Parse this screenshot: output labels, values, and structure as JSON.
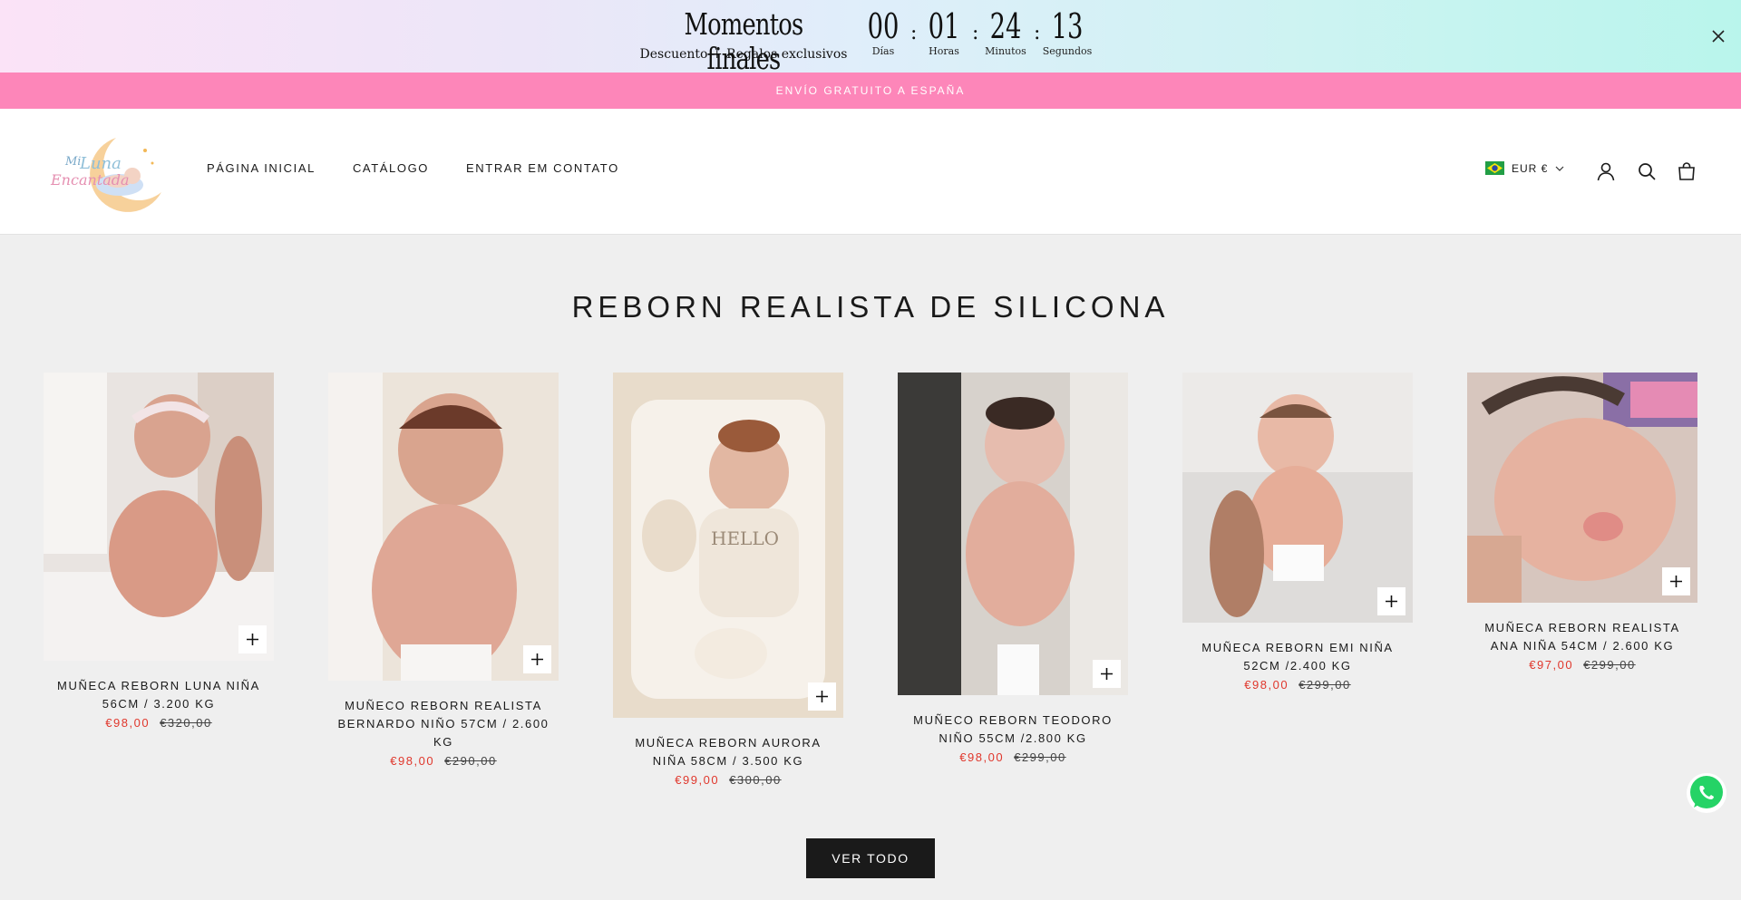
{
  "countdown": {
    "title": "Momentos finales",
    "subtitle": "Descuento + Regalos exclusivos",
    "units": [
      {
        "value": "00",
        "label": "Días"
      },
      {
        "value": "01",
        "label": "Horas"
      },
      {
        "value": "24",
        "label": "Minutos"
      },
      {
        "value": "13",
        "label": "Segundos"
      }
    ],
    "separator": ":"
  },
  "announcement": "ENVÍO GRATUITO A ESPAÑA",
  "header": {
    "logo_text": "Mi Luna Encantada",
    "nav": [
      "PÁGINA INICIAL",
      "CATÁLOGO",
      "ENTRAR EM CONTATO"
    ],
    "currency": "EUR €"
  },
  "section": {
    "title": "REBORN REALISTA DE SILICONA",
    "view_all": "VER TODO"
  },
  "products": [
    {
      "title": "MUÑECA REBORN LUNA NIÑA 56CM / 3.200 KG",
      "price": "€98,00",
      "compare": "€320,00"
    },
    {
      "title": "MUÑECO REBORN REALISTA BERNARDO NIÑO 57CM / 2.600 KG",
      "price": "€98,00",
      "compare": "€290,00"
    },
    {
      "title": "MUÑECA REBORN AURORA NIÑA 58CM / 3.500 KG",
      "price": "€99,00",
      "compare": "€300,00"
    },
    {
      "title": "MUÑECO REBORN TEODORO NIÑO 55CM /2.800 KG",
      "price": "€98,00",
      "compare": "€299,00"
    },
    {
      "title": "MUÑECA REBORN EMI NIÑA 52CM /2.400 KG",
      "price": "€98,00",
      "compare": "€299,00"
    },
    {
      "title": "MUÑECA REBORN REALISTA ANA NIÑA 54CM / 2.600 KG",
      "price": "€97,00",
      "compare": "€299,00"
    }
  ],
  "colors": {
    "announcement_bg": "#fd86b9",
    "sale_price": "#e0372c",
    "button_bg": "#1a1a1a"
  }
}
